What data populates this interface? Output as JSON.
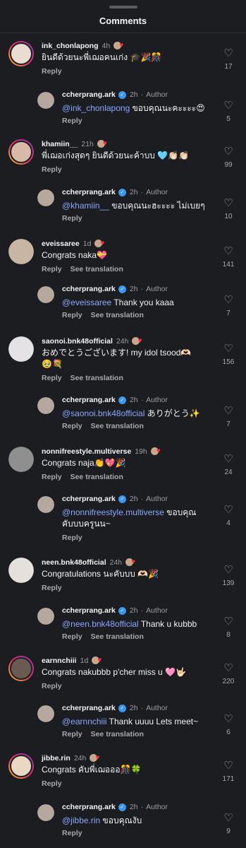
{
  "header": {
    "title": "Comments"
  },
  "ui": {
    "reply_label": "Reply",
    "see_translation_label": "See translation",
    "author_label": "Author"
  },
  "comments": [
    {
      "user": "ink_chonlapong",
      "time": "4h",
      "text": "ยินดีด้วยนะพี่เฌอคนเก่ง 🎓🎉🎊",
      "likes": "17",
      "reply": {
        "user": "ccherprang.ark",
        "time": "2h",
        "mention": "@ink_chonlapong",
        "text": " ขอบคุณนะคะะะะ😍",
        "likes": "5"
      }
    },
    {
      "user": "khamiin__",
      "time": "21h",
      "text": "พี่เฌอเก่งสุดๆ ยินดีด้วยนะค้าบบ 🩵👏🏻👏🏻",
      "likes": "99",
      "reply": {
        "user": "ccherprang.ark",
        "time": "2h",
        "mention": "@khamiin__",
        "text": " ขอบคุณนะฮะะะะ ไม่เบยๆ",
        "likes": "10"
      }
    },
    {
      "user": "eveissaree",
      "time": "1d",
      "text": "Congrats naka💝",
      "likes": "141",
      "reply": {
        "user": "ccherprang.ark",
        "time": "2h",
        "mention": "@eveissaree",
        "text": " Thank you kaaa",
        "likes": "7"
      }
    },
    {
      "user": "saonoi.bnk48official",
      "time": "24h",
      "text": "おめでとうございます!  my idol tsood🫶🏻",
      "text2": "🥹💐",
      "likes": "156",
      "reply": {
        "user": "ccherprang.ark",
        "time": "2h",
        "mention": "@saonoi.bnk48official",
        "text": " ありがとう✨",
        "likes": "7"
      }
    },
    {
      "user": "nonnifreestyle.multiverse",
      "time": "19h",
      "text": "Congrats naja👏💖🎉",
      "likes": "24",
      "reply": {
        "user": "ccherprang.ark",
        "time": "2h",
        "mention": "@nonnifreestyle.multiverse",
        "text": " ขอบคุณ",
        "text2": "คับบบครูนน~",
        "likes": "4"
      }
    },
    {
      "user": "neen.bnk48official",
      "time": "24h",
      "text": "Congratulations นะคับบบ 🫶🏻🎉",
      "likes": "139",
      "reply": {
        "user": "ccherprang.ark",
        "time": "2h",
        "mention": "@neen.bnk48official",
        "text": " Thank u kubbb",
        "likes": "8"
      }
    },
    {
      "user": "earnnchiii",
      "time": "1d",
      "text": "Congrats nakubbb p'cher miss u 🩷🤟🏻",
      "likes": "220",
      "reply": {
        "user": "ccherprang.ark",
        "time": "2h",
        "mention": "@earnnchiii",
        "text": " Thank uuuu Lets meet~",
        "likes": "6"
      }
    },
    {
      "user": "jibbe.rin",
      "time": "24h",
      "text": "Congrats คับพี่เฌอออ🎊🍀",
      "likes": "171",
      "reply": {
        "user": "ccherprang.ark",
        "time": "2h",
        "mention": "@jibbe.rin",
        "text": " ขอบคุณงับ",
        "likes": "9"
      }
    }
  ],
  "colors": {
    "background": "#1c1d20",
    "mention": "#8aa7ff",
    "heart_badge": "#ff3040",
    "verified": "#3897f0"
  },
  "icons": {
    "like": "heart-outline-icon",
    "verified": "verified-badge-icon",
    "creator_liked": "creator-heart-icon"
  }
}
